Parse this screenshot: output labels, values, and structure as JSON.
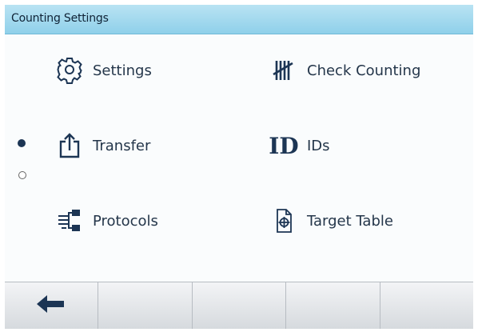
{
  "title": "Counting Settings",
  "menu": {
    "left": [
      {
        "label": "Settings",
        "icon": "gear-icon"
      },
      {
        "label": "Transfer",
        "icon": "upload-icon"
      },
      {
        "label": "Protocols",
        "icon": "protocols-icon"
      }
    ],
    "right": [
      {
        "label": "Check Counting",
        "icon": "tally-icon"
      },
      {
        "label": "IDs",
        "icon": "id-icon"
      },
      {
        "label": "Target Table",
        "icon": "target-table-icon"
      }
    ]
  },
  "id_icon_text": "ID",
  "pager": {
    "current_page": 1,
    "total_pages": 2
  },
  "softkeys": [
    {
      "icon": "back-arrow-icon"
    },
    {
      "icon": ""
    },
    {
      "icon": ""
    },
    {
      "icon": ""
    },
    {
      "icon": ""
    }
  ],
  "colors": {
    "title_bar": "#a3d9ef",
    "text": "#24364a",
    "icon": "#1c3554"
  }
}
